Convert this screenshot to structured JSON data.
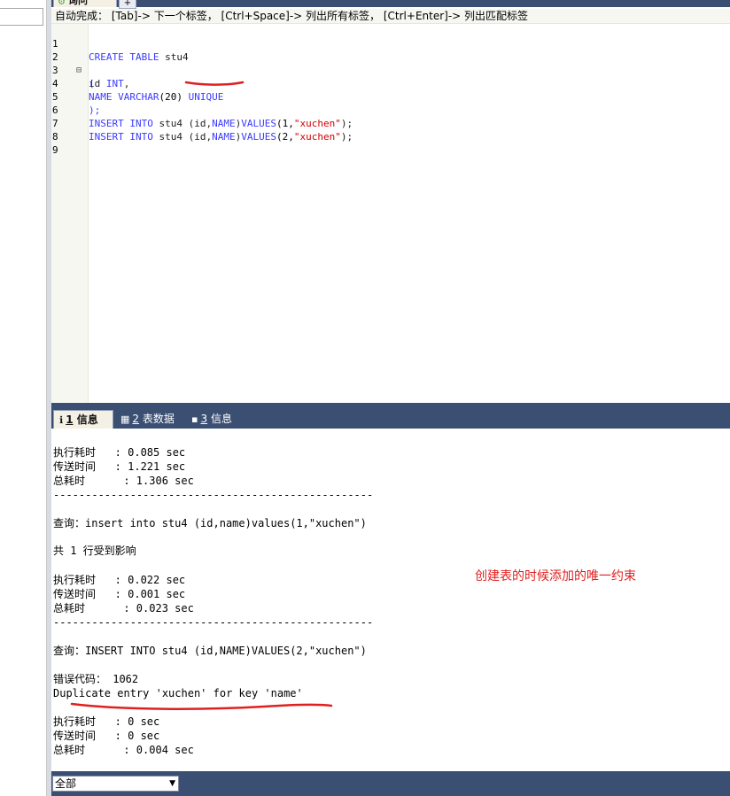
{
  "sidebar": {},
  "tabs": {
    "query_label": "询问",
    "add_label": "+"
  },
  "hint": "自动完成： [Tab]-> 下一个标签， [Ctrl+Space]-> 列出所有标签， [Ctrl+Enter]-> 列出匹配标签",
  "editor": {
    "line_numbers": [
      "1",
      "2",
      "3",
      "4",
      "5",
      "6",
      "7",
      "8",
      "9"
    ],
    "l1_kw1": "CREATE",
    "l1_kw2": "TABLE",
    "l1_id": "stu4",
    "l2": "(",
    "l3_id": "id",
    "l3_kw": "INT",
    "l3_tail": ",",
    "l4_kw1": "NAME",
    "l4_kw2": "VARCHAR",
    "l4_num": "(20)",
    "l4_kw3": "UNIQUE",
    "l5": ");",
    "l6_kw1": "INSERT",
    "l6_kw2": "INTO",
    "l6_mid": "stu4 (id,",
    "l6_kw3": "NAME",
    "l6_mid2": ")",
    "l6_kw4": "VALUES",
    "l6_num": "(1,",
    "l6_str": "\"xuchen\"",
    "l6_end": ");",
    "l7_kw1": "INSERT",
    "l7_kw2": "INTO",
    "l7_mid": "stu4 (id,",
    "l7_kw3": "NAME",
    "l7_mid2": ")",
    "l7_kw4": "VALUES",
    "l7_num": "(2,",
    "l7_str": "\"xuchen\"",
    "l7_end": ");"
  },
  "result_tabs": {
    "info": {
      "num": "1",
      "label": "信息"
    },
    "table_data": {
      "num": "2",
      "label": "表数据"
    },
    "info3": {
      "num": "3",
      "label": "信息"
    }
  },
  "output": {
    "block1": [
      "执行耗时   : 0.085 sec",
      "传送时间   : 1.221 sec",
      "总耗时      : 1.306 sec"
    ],
    "sep": "--------------------------------------------------",
    "query1": "查询：insert into stu4 (id,name)values(1,\"xuchen\")",
    "affected": "共 1 行受到影响",
    "block2": [
      "执行耗时   : 0.022 sec",
      "传送时间   : 0.001 sec",
      "总耗时      : 0.023 sec"
    ],
    "query2": "查询：INSERT INTO stu4 (id,NAME)VALUES(2,\"xuchen\")",
    "error_code": "错误代码： 1062",
    "error_msg": "Duplicate entry 'xuchen' for key 'name'",
    "block3": [
      "执行耗时   : 0 sec",
      "传送时间   : 0 sec",
      "总耗时      : 0.004 sec"
    ]
  },
  "annotation": "创建表的时候添加的唯一约束",
  "filter": {
    "selected": "全部"
  }
}
